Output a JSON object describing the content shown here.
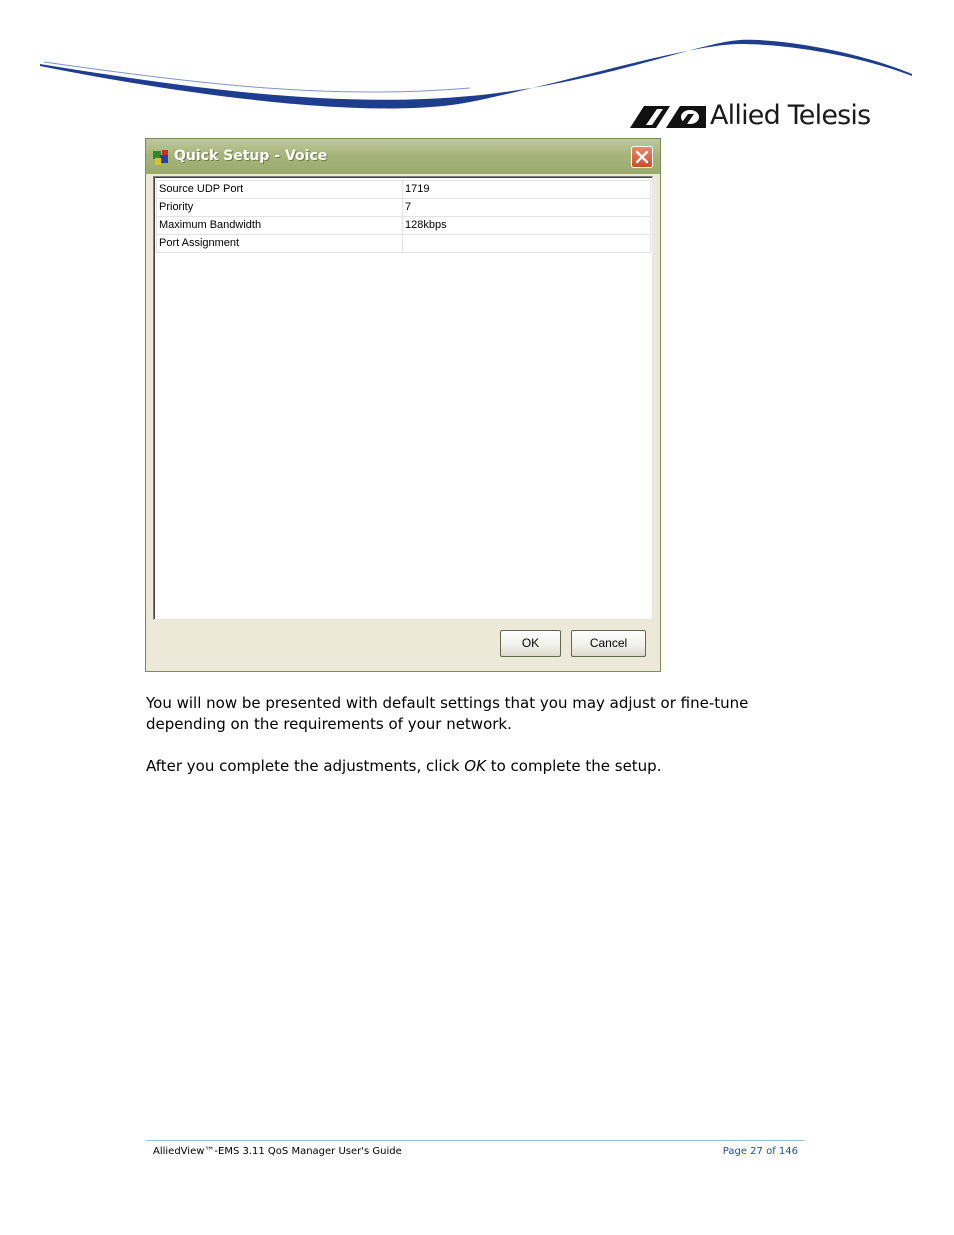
{
  "header": {
    "brand_name": "Allied Telesis",
    "colors": {
      "swoosh": "#1e3d8f",
      "swoosh_light": "#7d94c8"
    }
  },
  "dialog": {
    "title": "Quick Setup - Voice",
    "icon": "quick-setup-app-icon",
    "properties": [
      {
        "name": "Source UDP Port",
        "value": "1719"
      },
      {
        "name": "Priority",
        "value": "7"
      },
      {
        "name": "Maximum Bandwidth",
        "value": "128kbps"
      },
      {
        "name": "Port Assignment",
        "value": ""
      }
    ],
    "buttons": {
      "ok": "OK",
      "cancel": "Cancel"
    },
    "colors": {
      "titlebar": "#a7b57c",
      "close": "#d8552f",
      "face": "#ece9d8"
    }
  },
  "body": {
    "para1": "You will now be presented with default settings that you may adjust or fine-tune depending on the requirements of your network.",
    "para2_before": "After you complete the adjustments, click ",
    "para2_em": "OK",
    "para2_after": " to complete the setup."
  },
  "footer": {
    "guide_title": "AlliedView™-EMS 3.11 QoS Manager User's Guide",
    "page": "Page 27 of 146"
  }
}
